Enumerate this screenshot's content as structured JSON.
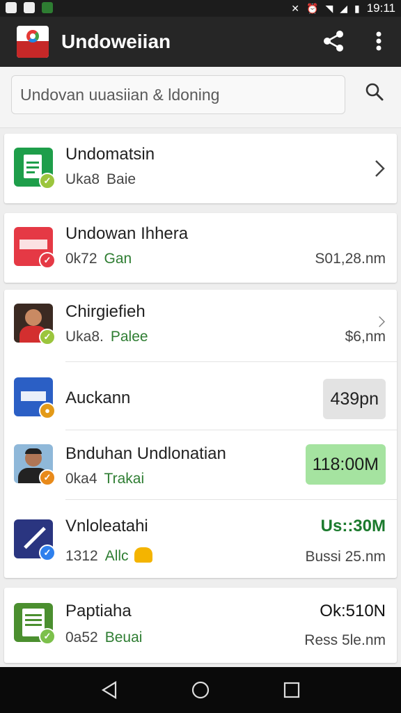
{
  "status_bar": {
    "time": "19:11"
  },
  "app_bar": {
    "title": "Undoweiian"
  },
  "search": {
    "placeholder": "Undovan uuasiian & ldoning"
  },
  "items": [
    {
      "title": "Undomatsin",
      "subtitle": "Uka8",
      "subtitle_accent": "Baie",
      "accent_color": "#444444"
    },
    {
      "title": "Undowan Ihhera",
      "subtitle": "0k72",
      "subtitle_accent": "Gan",
      "right_text": "S01,28.nm"
    },
    {
      "title": "Chirgiefieh",
      "subtitle": "Uka8.",
      "subtitle_accent": "Palee",
      "right_text": "$6,nm"
    },
    {
      "title": "Auckann",
      "pill": "439pn"
    },
    {
      "title": "Bnduhan Undlonatian",
      "subtitle": "0ka4",
      "subtitle_accent": "Trakai",
      "pill": "118:00M"
    },
    {
      "title": "Vnloleatahi",
      "subtitle": "1312",
      "subtitle_accent": "Allc",
      "right_top": "Us::30M",
      "right_text": "Bussi 25.nm"
    },
    {
      "title": "Paptiaha",
      "subtitle": "0a52",
      "subtitle_accent": "Beuai",
      "right_top": "Ok:510N",
      "right_text": "Ress 5le.nm"
    }
  ],
  "colors": {
    "app_bar": "#262626",
    "accent_green": "#2e7d32",
    "pill_green": "#a5e3a0",
    "pill_grey": "#e3e3e3"
  },
  "icons": [
    "share-icon",
    "more-vert-icon",
    "search-icon",
    "chevron-right-icon",
    "back-icon",
    "home-icon",
    "recents-icon"
  ]
}
